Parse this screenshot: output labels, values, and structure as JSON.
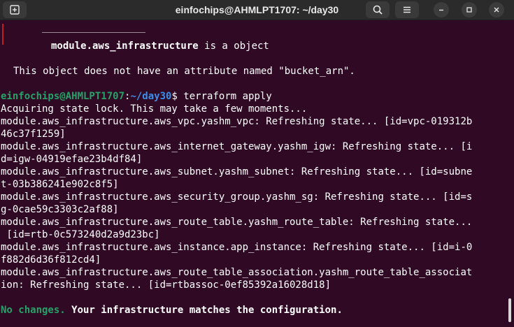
{
  "window": {
    "title": "einfochips@AHMLPT1707: ~/day30"
  },
  "titlebar": {
    "icons": [
      "new-tab-icon",
      "search-icon",
      "hamburger-menu-icon",
      "minimize-icon",
      "maximize-icon",
      "close-icon"
    ]
  },
  "terminal": {
    "error_object": "module.aws_infrastructure",
    "error_object_suffix": " is a object",
    "error_message": "This object does not have an attribute named \"bucket_arn\".",
    "prompt_user": "einfochips@AHMLPT1707",
    "prompt_sep": ":",
    "prompt_path": "~/day30",
    "prompt_cmd": "$ terraform apply",
    "lines": [
      "Acquiring state lock. This may take a few moments...",
      "module.aws_infrastructure.aws_vpc.yashm_vpc: Refreshing state... [id=vpc-019312b",
      "46c37f1259]",
      "module.aws_infrastructure.aws_internet_gateway.yashm_igw: Refreshing state... [i",
      "d=igw-04919efae23b4df84]",
      "module.aws_infrastructure.aws_subnet.yashm_subnet: Refreshing state... [id=subne",
      "t-03b386241e902c8f5]",
      "module.aws_infrastructure.aws_security_group.yashm_sg: Refreshing state... [id=s",
      "g-0cae59c3303c2af88]",
      "module.aws_infrastructure.aws_route_table.yashm_route_table: Refreshing state...",
      " [id=rtb-0c573240d2a9d23bc]",
      "module.aws_infrastructure.aws_instance.app_instance: Refreshing state... [id=i-0",
      "f882d6d36f812cd4]",
      "module.aws_infrastructure.aws_route_table_association.yashm_route_table_associat",
      "ion: Refreshing state... [id=rtbassoc-0ef85392a16028d18]"
    ],
    "result_green": "No changes.",
    "result_bold": " Your infrastructure matches the configuration."
  },
  "colors": {
    "background": "#300a24",
    "prompt_user": "#26a269",
    "prompt_path": "#3b8eea",
    "titlebar": "#2b2b2b"
  }
}
